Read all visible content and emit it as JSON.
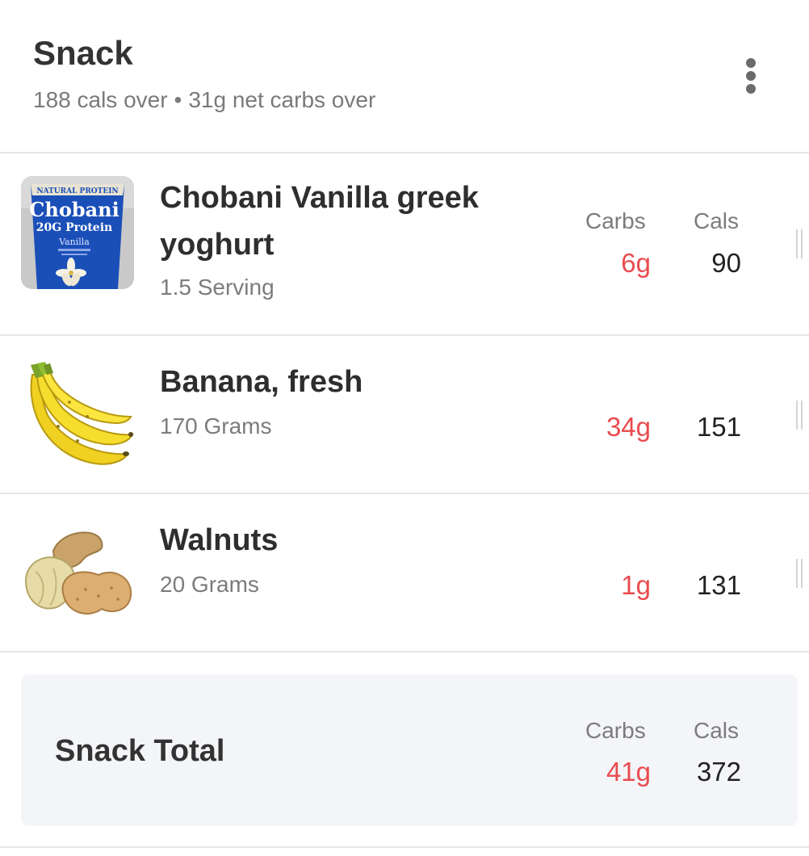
{
  "header": {
    "title": "Snack",
    "cals_status": "188 cals over",
    "separator": "•",
    "carbs_status": "31g net carbs over"
  },
  "columns": {
    "carbs_label": "Carbs",
    "cals_label": "Cals"
  },
  "items": [
    {
      "name": "Chobani Vanilla greek yoghurt",
      "serving": "1.5 Serving",
      "carbs": "6g",
      "cals": "90",
      "icon": "yogurt-cup-icon",
      "image_text": [
        "NATURAL PROTEIN",
        "Chobani",
        "20G Protein",
        "Vanilla"
      ]
    },
    {
      "name": "Banana, fresh",
      "serving": "170 Grams",
      "carbs": "34g",
      "cals": "151",
      "icon": "banana-icon"
    },
    {
      "name": "Walnuts",
      "serving": "20 Grams",
      "carbs": "1g",
      "cals": "131",
      "icon": "nuts-icon"
    }
  ],
  "total": {
    "title": "Snack Total",
    "carbs": "41g",
    "cals": "372"
  },
  "colors": {
    "carbs": "#e84c4f",
    "total_background": "#f4f5f8",
    "divider": "#e6e6e6"
  }
}
